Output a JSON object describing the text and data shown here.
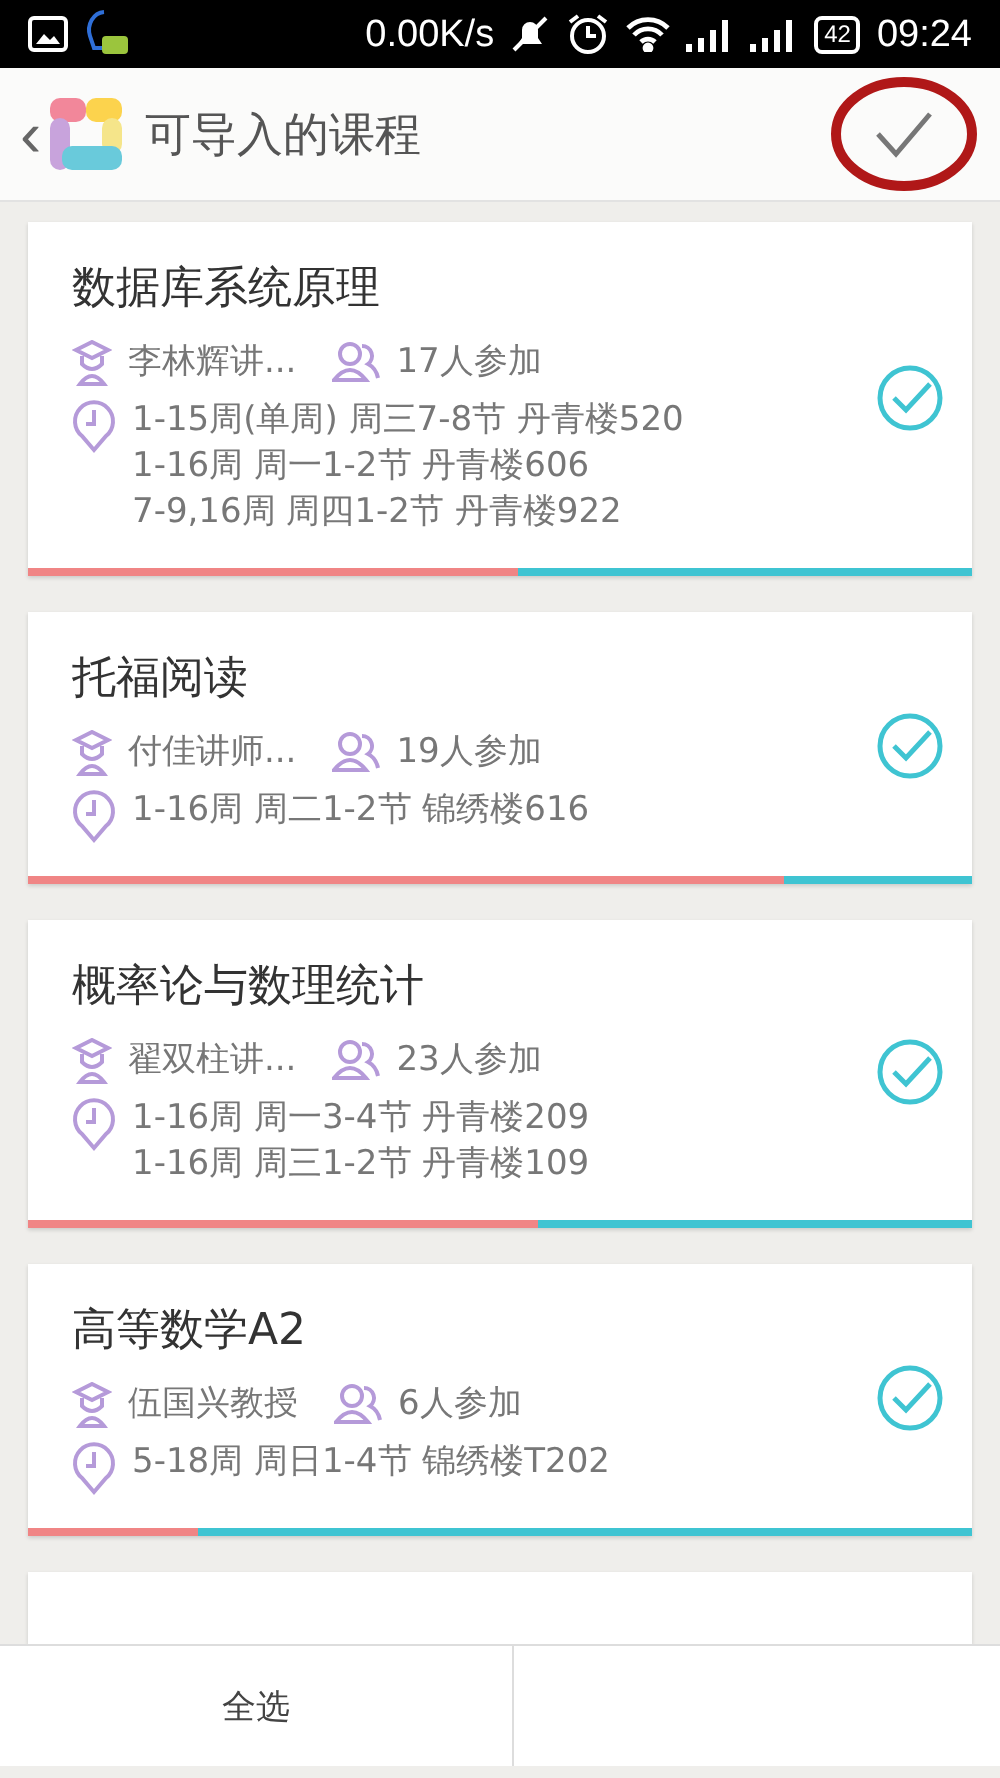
{
  "status_bar": {
    "speed": "0.00K/s",
    "battery": "42",
    "time": "09:24"
  },
  "header": {
    "back": "‹",
    "title": "可导入的课程",
    "confirm_highlighted": true
  },
  "courses": [
    {
      "title": "数据库系统原理",
      "teacher": "李林辉讲...",
      "participants": "17人参加",
      "schedule": [
        "1-15周(单周) 周三7-8节 丹青楼520",
        "1-16周 周一1-2节 丹青楼606",
        "7-9,16周 周四1-2节 丹青楼922"
      ],
      "selected": true,
      "level": 0.52
    },
    {
      "title": "托福阅读",
      "teacher": "付佳讲师...",
      "participants": "19人参加",
      "schedule": [
        "1-16周 周二1-2节 锦绣楼616"
      ],
      "selected": true,
      "level": 0.8
    },
    {
      "title": "概率论与数理统计",
      "teacher": "翟双柱讲...",
      "participants": "23人参加",
      "schedule": [
        "1-16周 周一3-4节 丹青楼209",
        "1-16周 周三1-2节 丹青楼109"
      ],
      "selected": true,
      "level": 0.54
    },
    {
      "title": "高等数学A2",
      "teacher": "伍国兴教授",
      "participants": "6人参加",
      "schedule": [
        "5-18周 周日1-4节 锦绣楼T202"
      ],
      "selected": true,
      "level": 0.18
    }
  ],
  "bottom_bar": {
    "select_all": "全选"
  }
}
